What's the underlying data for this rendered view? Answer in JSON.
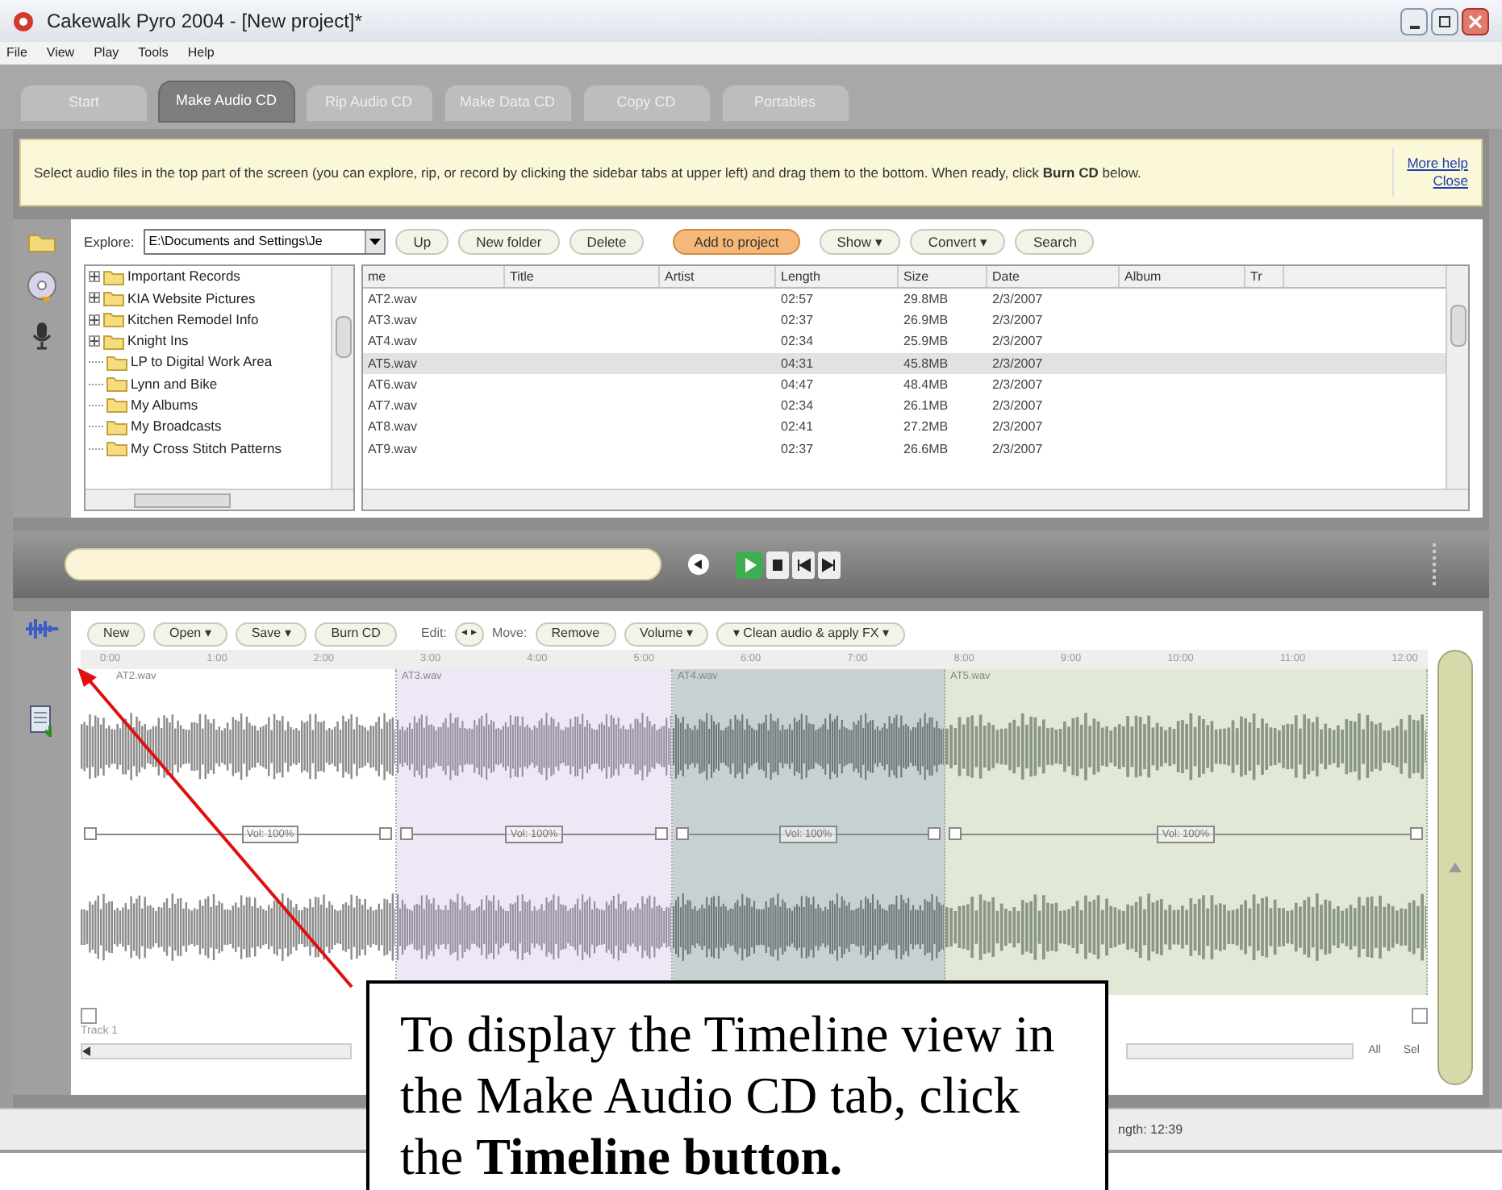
{
  "window": {
    "title": "Cakewalk Pyro 2004 - [New project]*"
  },
  "menu": [
    "File",
    "View",
    "Play",
    "Tools",
    "Help"
  ],
  "tabs": [
    {
      "label": "Start",
      "selected": false
    },
    {
      "label": "Make Audio CD",
      "selected": true
    },
    {
      "label": "Rip Audio CD",
      "selected": false
    },
    {
      "label": "Make Data CD",
      "selected": false
    },
    {
      "label": "Copy CD",
      "selected": false
    },
    {
      "label": "Portables",
      "selected": false
    }
  ],
  "help_bar": {
    "text": "Select audio files in the top part of the screen (you can explore, rip, or record by clicking the sidebar tabs at upper left) and drag them to the bottom. When ready, click **Burn CD** below.",
    "links": [
      "More help",
      "Close"
    ]
  },
  "explorer": {
    "label": "Explore:",
    "path": "E:\\Documents and Settings\\Je",
    "buttons": [
      {
        "label": "Up",
        "kind": "plain"
      },
      {
        "label": "New folder",
        "kind": "plain"
      },
      {
        "label": "Delete",
        "kind": "plain"
      },
      {
        "label": "Add to project",
        "kind": "primary"
      },
      {
        "label": "Show ▾",
        "kind": "plain"
      },
      {
        "label": "Convert ▾",
        "kind": "plain"
      },
      {
        "label": "Search",
        "kind": "plain"
      }
    ],
    "tree": [
      {
        "label": "Important Records",
        "expandable": true
      },
      {
        "label": "KIA Website Pictures",
        "expandable": true
      },
      {
        "label": "Kitchen Remodel Info",
        "expandable": true
      },
      {
        "label": "Knight Ins",
        "expandable": true
      },
      {
        "label": "LP to Digital Work Area",
        "expandable": false
      },
      {
        "label": "Lynn and Bike",
        "expandable": false
      },
      {
        "label": "My Albums",
        "expandable": false
      },
      {
        "label": "My Broadcasts",
        "expandable": false
      },
      {
        "label": "My Cross Stitch Patterns",
        "expandable": false
      }
    ],
    "table": {
      "columns": [
        "me",
        "Title",
        "Artist",
        "Length",
        "Size",
        "Date",
        "Album",
        "Tr"
      ],
      "rows": [
        {
          "name": "AT2.wav",
          "length": "02:57",
          "size": "29.8MB",
          "date": "2/3/2007",
          "selected": false
        },
        {
          "name": "AT3.wav",
          "length": "02:37",
          "size": "26.9MB",
          "date": "2/3/2007",
          "selected": false
        },
        {
          "name": "AT4.wav",
          "length": "02:34",
          "size": "25.9MB",
          "date": "2/3/2007",
          "selected": false
        },
        {
          "name": "AT5.wav",
          "length": "04:31",
          "size": "45.8MB",
          "date": "2/3/2007",
          "selected": true
        },
        {
          "name": "AT6.wav",
          "length": "04:47",
          "size": "48.4MB",
          "date": "2/3/2007",
          "selected": false
        },
        {
          "name": "AT7.wav",
          "length": "02:34",
          "size": "26.1MB",
          "date": "2/3/2007",
          "selected": false
        },
        {
          "name": "AT8.wav",
          "length": "02:41",
          "size": "27.2MB",
          "date": "2/3/2007",
          "selected": false
        },
        {
          "name": "AT9.wav",
          "length": "02:37",
          "size": "26.6MB",
          "date": "2/3/2007",
          "selected": false
        }
      ]
    }
  },
  "timeline": {
    "toolbar": [
      {
        "kind": "button",
        "label": "New"
      },
      {
        "kind": "button",
        "label": "Open ▾"
      },
      {
        "kind": "button",
        "label": "Save ▾"
      },
      {
        "kind": "button",
        "label": "Burn CD"
      },
      {
        "kind": "label",
        "label": "Edit:"
      },
      {
        "kind": "nudge",
        "label": "◂ ▸"
      },
      {
        "kind": "label",
        "label": "Move:"
      },
      {
        "kind": "button",
        "label": "Remove"
      },
      {
        "kind": "button",
        "label": "Volume ▾"
      },
      {
        "kind": "button",
        "label": "▾ Clean audio & apply FX ▾"
      }
    ],
    "ruler": [
      "0:00",
      "1:00",
      "2:00",
      "3:00",
      "4:00",
      "5:00",
      "6:00",
      "7:00",
      "8:00",
      "9:00",
      "10:00",
      "11:00",
      "12:00"
    ],
    "clips": [
      {
        "label": "AT2.wav",
        "volume": "Vol: 100%",
        "color": "#ffffff"
      },
      {
        "label": "AT3.wav",
        "volume": "Vol: 100%",
        "color": "#efe6f6"
      },
      {
        "label": "AT4.wav",
        "volume": "Vol: 100%",
        "color": "#c7d1d1"
      },
      {
        "label": "AT5.wav",
        "volume": "Vol: 100%",
        "color": "#e1e9d6"
      }
    ],
    "track_label": "Track 1",
    "zoom": [
      "All",
      "Sel"
    ]
  },
  "status_bar": {
    "length": "ngth: 12:39"
  },
  "callout": {
    "text": "To display the Timeline view in the Make Audio CD tab, click the **Timeline button.**"
  }
}
